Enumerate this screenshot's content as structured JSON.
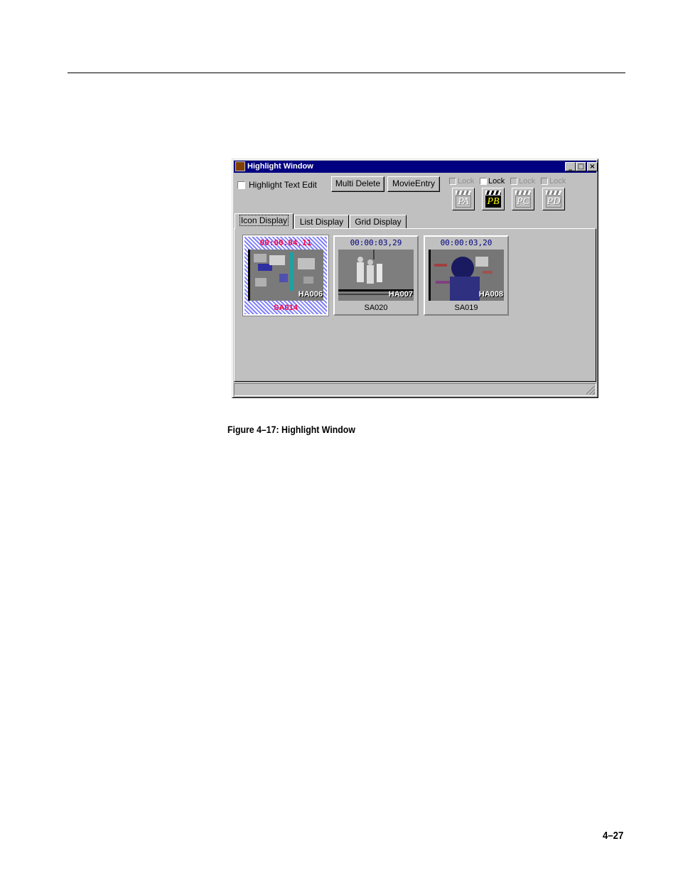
{
  "window": {
    "title": "Highlight Window",
    "minimize_glyph": "_",
    "maximize_glyph": "□",
    "close_glyph": "×"
  },
  "toolbar": {
    "highlight_text_edit_label": "Highlight Text Edit",
    "highlight_text_edit_checked": false,
    "multi_delete_label": "Multi Delete",
    "movie_entry_label": "MovieEntry"
  },
  "locks": [
    {
      "label": "Lock",
      "enabled": false
    },
    {
      "label": "Lock",
      "enabled": true
    },
    {
      "label": "Lock",
      "enabled": false
    },
    {
      "label": "Lock",
      "enabled": false
    }
  ],
  "player_buttons": [
    {
      "label": "PA",
      "active": false
    },
    {
      "label": "PB",
      "active": true
    },
    {
      "label": "PC",
      "active": false
    },
    {
      "label": "PD",
      "active": false
    }
  ],
  "tabs": [
    {
      "label": "Icon Display",
      "selected": true
    },
    {
      "label": "List Display",
      "selected": false
    },
    {
      "label": "Grid Display",
      "selected": false
    }
  ],
  "thumbnails": [
    {
      "time": "00:00:04,11",
      "code": "HA006",
      "name": "SA014",
      "selected": true
    },
    {
      "time": "00:00:03,29",
      "code": "HA007",
      "name": "SA020",
      "selected": false
    },
    {
      "time": "00:00:03,20",
      "code": "HA008",
      "name": "SA019",
      "selected": false
    }
  ],
  "document": {
    "caption": "Figure 4–17: Highlight Window",
    "page_number": "4–27"
  }
}
